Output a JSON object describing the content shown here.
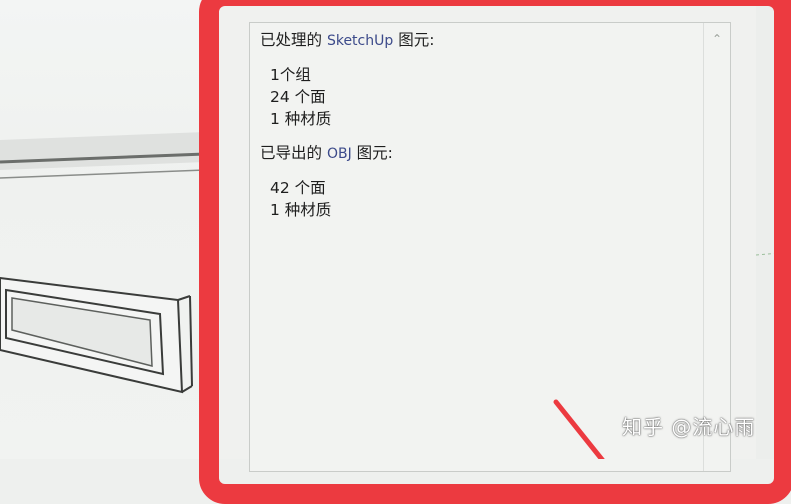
{
  "dialog": {
    "processed": {
      "prefix": "已处理的",
      "app": "SketchUp",
      "suffix": "图元:",
      "items": [
        "1个组",
        "24 个面",
        "1 种材质"
      ]
    },
    "exported": {
      "prefix": "已导出的",
      "format": "OBJ",
      "suffix": "图元:",
      "items": [
        "42 个面",
        "1 种材质"
      ]
    }
  },
  "watermark": "知乎 @流心雨",
  "colors": {
    "highlight": "#ec3a40",
    "dialog_bg": "#f0f1ef",
    "latin_text": "#3c4a8a"
  }
}
